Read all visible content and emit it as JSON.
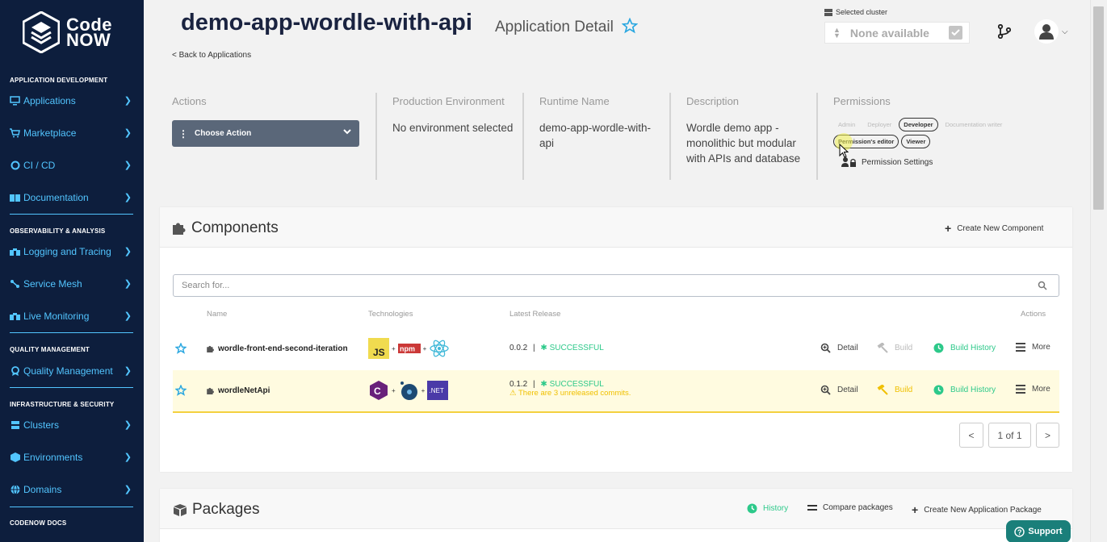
{
  "brand": {
    "line1": "Code",
    "line2": "NOW"
  },
  "sidebar": {
    "sections": {
      "app_dev": "APPLICATION DEVELOPMENT",
      "observability": "OBSERVABILITY & ANALYSIS",
      "quality": "QUALITY MANAGEMENT",
      "infra": "INFRASTRUCTURE & SECURITY",
      "docs": "CODENOW DOCS"
    },
    "items": {
      "applications": "Applications",
      "marketplace": "Marketplace",
      "cicd": "CI / CD",
      "documentation": "Documentation",
      "logging": "Logging and Tracing",
      "service_mesh": "Service Mesh",
      "live_monitoring": "Live Monitoring",
      "quality_management": "Quality Management",
      "clusters": "Clusters",
      "environments": "Environments",
      "domains": "Domains"
    }
  },
  "header": {
    "title": "demo-app-wordle-with-api",
    "subtitle": "Application Detail",
    "back": "< Back to Applications",
    "cluster_label": "Selected cluster",
    "cluster_value": "None available"
  },
  "info": {
    "actions_label": "Actions",
    "choose_action": "Choose Action",
    "prod_env_label": "Production Environment",
    "prod_env_value": "No environment selected",
    "runtime_label": "Runtime Name",
    "runtime_value": "demo-app-wordle-with-api",
    "desc_label": "Description",
    "desc_value": "Wordle demo app - monolithic but modular with APIs and database",
    "perm_label": "Permissions",
    "perm_tags": [
      "Admin",
      "Deployer",
      "Developer",
      "Documentation writer",
      "Permission's editor",
      "Viewer"
    ],
    "perm_settings": "Permission Settings"
  },
  "components": {
    "title": "Components",
    "create": "Create New Component",
    "search_placeholder": "Search for...",
    "columns": {
      "name": "Name",
      "tech": "Technologies",
      "release": "Latest Release",
      "actions": "Actions"
    },
    "rows": [
      {
        "name": "wordle-front-end-second-iteration",
        "version": "0.0.2",
        "sep": "|",
        "status": "SUCCESSFUL",
        "tech": [
          "JS",
          "npm",
          "React"
        ]
      },
      {
        "name": "wordleNetApi",
        "version": "0.1.2",
        "sep": "|",
        "status": "SUCCESSFUL",
        "warning": "There are 3 unreleased commits.",
        "tech": [
          "C#",
          "Docker",
          ".NET"
        ]
      }
    ],
    "actions": {
      "detail": "Detail",
      "build": "Build",
      "history": "Build History",
      "more": "More"
    },
    "pager": {
      "prev": "<",
      "page": "1 of 1",
      "next": ">"
    }
  },
  "packages": {
    "title": "Packages",
    "history": "History",
    "compare": "Compare packages",
    "create": "Create New Application Package"
  },
  "support": "Support",
  "colors": {
    "sidebar": "#0d1e3d",
    "link": "#52c5ff",
    "success": "#2dc98a",
    "warning": "#f0c000",
    "highlight": "#fffbe0"
  }
}
